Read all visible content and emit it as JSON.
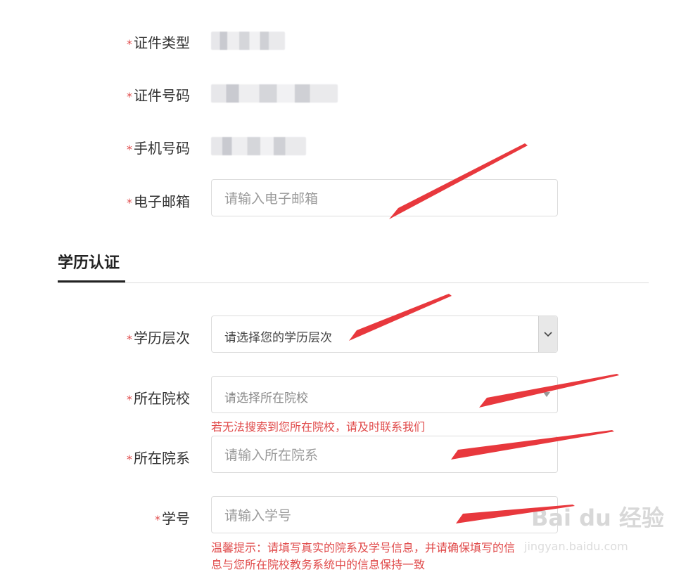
{
  "personal": {
    "fields": [
      {
        "label": "证件类型"
      },
      {
        "label": "证件号码"
      },
      {
        "label": "手机号码"
      }
    ],
    "email": {
      "label": "电子邮箱",
      "placeholder": "请输入电子邮箱"
    }
  },
  "education": {
    "section_title": "学历认证",
    "level": {
      "label": "学历层次",
      "selected": "请选择您的学历层次"
    },
    "school": {
      "label": "所在院校",
      "selected": "请选择所在院校",
      "hint": "若无法搜索到您所在院校，请及时联系我们"
    },
    "department": {
      "label": "所在院系",
      "placeholder": "请输入所在院系"
    },
    "student_id": {
      "label": "学号",
      "placeholder": "请输入学号"
    },
    "tip_line1": "温馨提示：请填写真实的院系及学号信息，并请确保填写的信",
    "tip_line2": "息与您所在院校教务系统中的信息保持一致"
  },
  "required_mark": "*",
  "watermark": {
    "brand": "Bai du 经验",
    "url": "jingyan.baidu.com"
  },
  "colors": {
    "required": "#e04a4a",
    "arrow": "#e8383d",
    "hint": "#e04a4a"
  }
}
